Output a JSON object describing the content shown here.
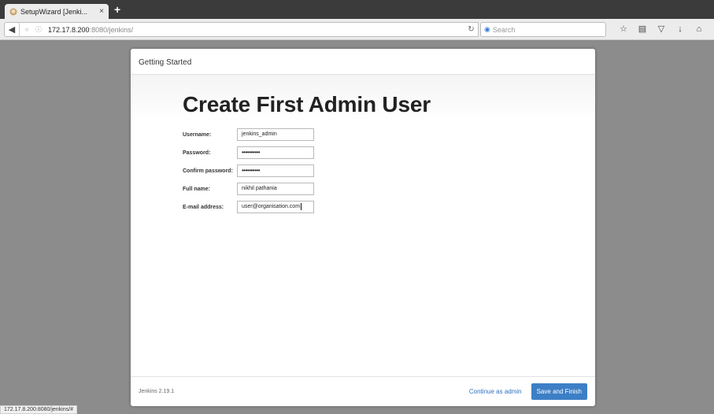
{
  "browser": {
    "tab_title": "SetupWizard [Jenki...",
    "tab_close": "×",
    "new_tab": "+",
    "url_host": "172.17.8.200",
    "url_path": ":8080/jenkins/",
    "search_placeholder": "Search",
    "status_url": "172.17.8.200:8080/jenkins/#"
  },
  "page": {
    "header_title": "Getting Started",
    "heading": "Create First Admin User",
    "fields": [
      {
        "label": "Username:",
        "value": "jenkins_admin"
      },
      {
        "label": "Password:",
        "value": "••••••••••"
      },
      {
        "label": "Confirm password:",
        "value": "••••••••••"
      },
      {
        "label": "Full name:",
        "value": "nikhil pathania"
      },
      {
        "label": "E-mail address:",
        "value": "user@organisation.com"
      }
    ],
    "footer_version": "Jenkins 2.19.1",
    "continue_label": "Continue as admin",
    "save_label": "Save and Finish"
  },
  "colors": {
    "accent": "#3d7fc6",
    "link": "#2f6fbf",
    "backdrop": "#8c8c8c"
  }
}
